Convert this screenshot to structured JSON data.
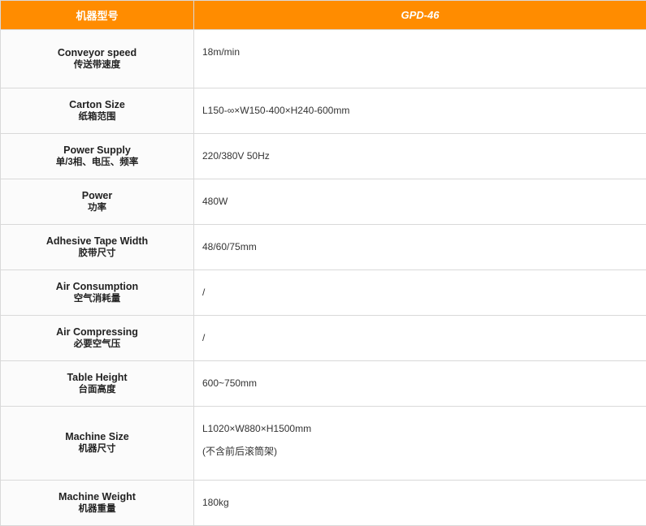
{
  "header": {
    "model_label": "机器型号",
    "model_value": "GPD-46"
  },
  "rows": [
    {
      "en": "Conveyor speed",
      "zh": "传送带速度",
      "values": [
        "18m/min"
      ]
    },
    {
      "en": "Carton Size",
      "zh": "纸箱范围",
      "values": [
        "L150-∞×W150-400×H240-600mm"
      ]
    },
    {
      "en": "Power Supply",
      "zh": "单/3相、电压、频率",
      "values": [
        "220/380V 50Hz"
      ]
    },
    {
      "en": "Power",
      "zh": "功率",
      "values": [
        "480W"
      ]
    },
    {
      "en": "Adhesive Tape Width",
      "zh": "胶带尺寸",
      "values": [
        "48/60/75mm"
      ]
    },
    {
      "en": "Air Consumption",
      "zh": "空气消耗量",
      "values": [
        "/"
      ]
    },
    {
      "en": "Air Compressing",
      "zh": "必要空气压",
      "values": [
        "/"
      ]
    },
    {
      "en": "Table Height",
      "zh": "台面高度",
      "values": [
        "600~750mm"
      ]
    },
    {
      "en": "Machine Size",
      "zh": "机器尺寸",
      "values": [
        "L1020×W880×H1500mm",
        "(不含前后滚筒架)"
      ]
    },
    {
      "en": "Machine Weight",
      "zh": "机器重量",
      "values": [
        "180kg"
      ]
    }
  ]
}
